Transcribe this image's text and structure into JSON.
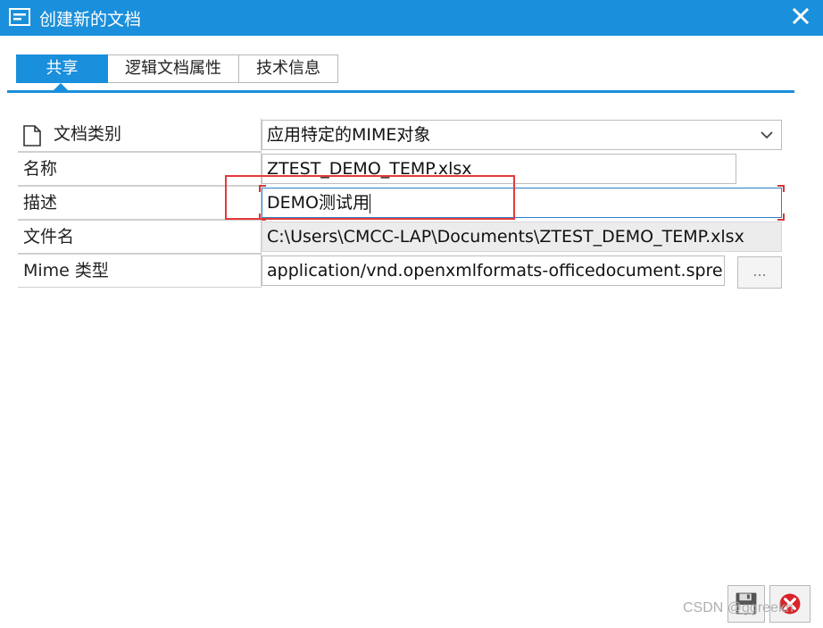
{
  "window": {
    "title": "创建新的文档",
    "accent_color": "#1a8fdb"
  },
  "tabs": [
    {
      "label": "共享",
      "active": true
    },
    {
      "label": "逻辑文档属性",
      "active": false
    },
    {
      "label": "技术信息",
      "active": false
    }
  ],
  "form": {
    "doc_category": {
      "label": "文档类别",
      "value": "应用特定的MIME对象",
      "icon": "document-icon"
    },
    "name": {
      "label": "名称",
      "value": "ZTEST_DEMO_TEMP.xlsx"
    },
    "description": {
      "label": "描述",
      "value": "DEMO测试用"
    },
    "filename": {
      "label": "文件名",
      "value": "C:\\Users\\CMCC-LAP\\Documents\\ZTEST_DEMO_TEMP.xlsx"
    },
    "mime_type": {
      "label": "Mime 类型",
      "value": "application/vnd.openxmlformats-officedocument.spre…",
      "browse_label": "..."
    }
  },
  "buttons": {
    "save_icon": "floppy-disk-icon",
    "cancel_icon": "cancel-icon"
  },
  "watermark": "CSDN @ggreekn"
}
